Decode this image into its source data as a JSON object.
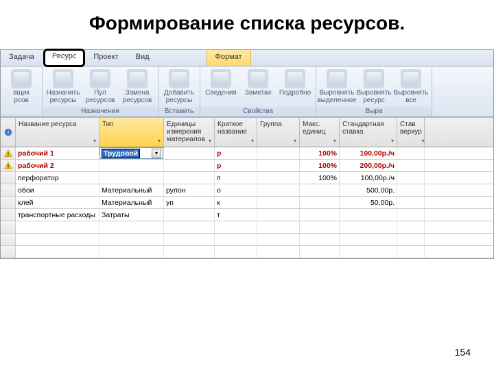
{
  "slide": {
    "title": "Формирование списка ресурсов.",
    "page_number": "154"
  },
  "tabs": {
    "items": [
      "Задача",
      "Ресурс",
      "Проект",
      "Вид"
    ],
    "contextual": "Формат",
    "active_index": 1
  },
  "ribbon": {
    "groups": [
      {
        "label": "",
        "buttons": [
          "вщик\nрсов"
        ]
      },
      {
        "label": "Назначения",
        "buttons": [
          "Назначить\nресурсы",
          "Пул\nресурсов",
          "Замена\nресурсов"
        ]
      },
      {
        "label": "Вставить",
        "buttons": [
          "Добавить\nресурсы"
        ]
      },
      {
        "label": "Свойства",
        "buttons": [
          "Сведения",
          "Заметки",
          "Подробно"
        ]
      },
      {
        "label": "Выра",
        "buttons": [
          "Выровнять\nвыделенное",
          "Выровнять\nресурс",
          "Выровнять\nвсе"
        ]
      }
    ]
  },
  "columns": [
    {
      "key": "name",
      "label": "Название ресурса",
      "w": "w-name"
    },
    {
      "key": "type",
      "label": "Тип",
      "w": "w-type",
      "active": true
    },
    {
      "key": "unit",
      "label": "Единицы измерения материалов",
      "w": "w-unit"
    },
    {
      "key": "short",
      "label": "Краткое название",
      "w": "w-short"
    },
    {
      "key": "group",
      "label": "Группа",
      "w": "w-group"
    },
    {
      "key": "max",
      "label": "Макс. единиц",
      "w": "w-max"
    },
    {
      "key": "rate",
      "label": "Стандартная ставка",
      "w": "w-rate"
    },
    {
      "key": "over",
      "label": "Став верхур",
      "w": "w-over"
    }
  ],
  "dropdown": {
    "selected": "Трудовой",
    "options": [
      "Трудовой",
      "Материальный",
      "Затраты"
    ]
  },
  "rows": [
    {
      "warn": true,
      "red": true,
      "name": "рабочий 1",
      "type": "__DROPDOWN__",
      "unit": "",
      "short": "р",
      "group": "",
      "max": "100%",
      "rate": "100,00р./ч"
    },
    {
      "warn": true,
      "red": true,
      "name": "рабочий 2",
      "type": "",
      "unit": "",
      "short": "р",
      "group": "",
      "max": "100%",
      "rate": "200,00р./ч"
    },
    {
      "warn": false,
      "red": false,
      "name": "перфоратор",
      "type": "",
      "unit": "",
      "short": "п",
      "group": "",
      "max": "100%",
      "rate": "100,00р./ч"
    },
    {
      "warn": false,
      "red": false,
      "name": "обои",
      "type": "Материальный",
      "unit": "рулон",
      "short": "о",
      "group": "",
      "max": "",
      "rate": "500,00р."
    },
    {
      "warn": false,
      "red": false,
      "name": "клей",
      "type": "Материальный",
      "unit": "уп",
      "short": "к",
      "group": "",
      "max": "",
      "rate": "50,00р."
    },
    {
      "warn": false,
      "red": false,
      "name": "транспортные расходы",
      "type": "Затраты",
      "unit": "",
      "short": "т",
      "group": "",
      "max": "",
      "rate": ""
    },
    {
      "warn": false,
      "red": false,
      "name": "",
      "type": "",
      "unit": "",
      "short": "",
      "group": "",
      "max": "",
      "rate": ""
    },
    {
      "warn": false,
      "red": false,
      "name": "",
      "type": "",
      "unit": "",
      "short": "",
      "group": "",
      "max": "",
      "rate": ""
    },
    {
      "warn": false,
      "red": false,
      "name": "",
      "type": "",
      "unit": "",
      "short": "",
      "group": "",
      "max": "",
      "rate": ""
    }
  ]
}
